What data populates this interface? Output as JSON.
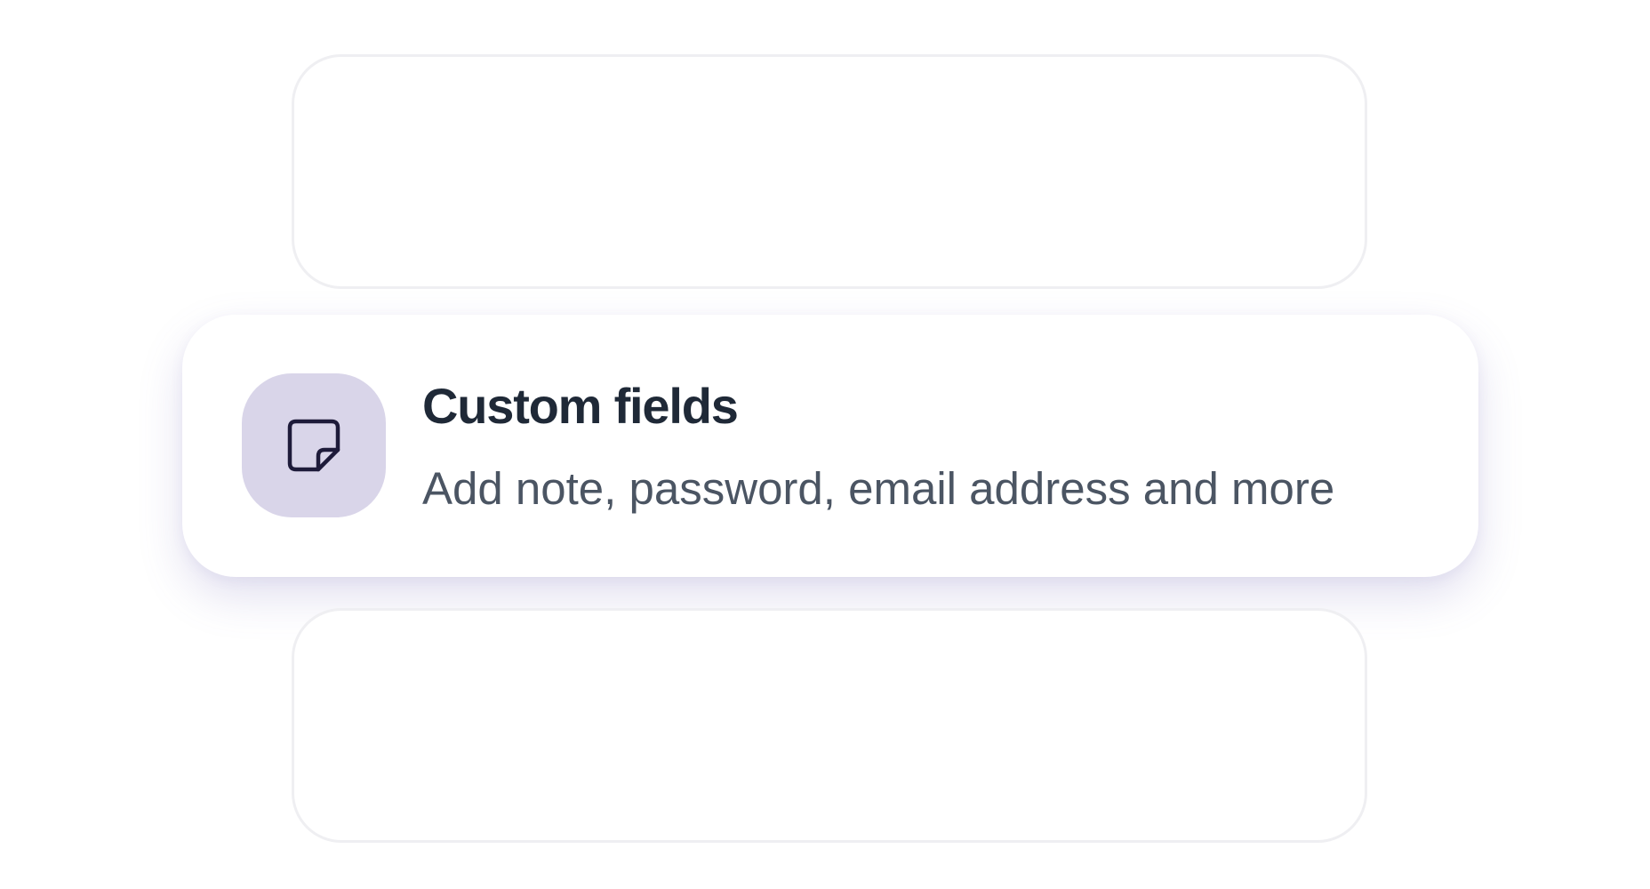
{
  "feature": {
    "title": "Custom fields",
    "description": "Add note, password, email address and more",
    "icon": "sticky-note-icon"
  },
  "colors": {
    "icon_tile_bg": "#d9d5e9",
    "icon_stroke": "#1e1b3a",
    "title": "#1f2937",
    "description": "#4b5563",
    "ghost_border": "#efeff2"
  }
}
